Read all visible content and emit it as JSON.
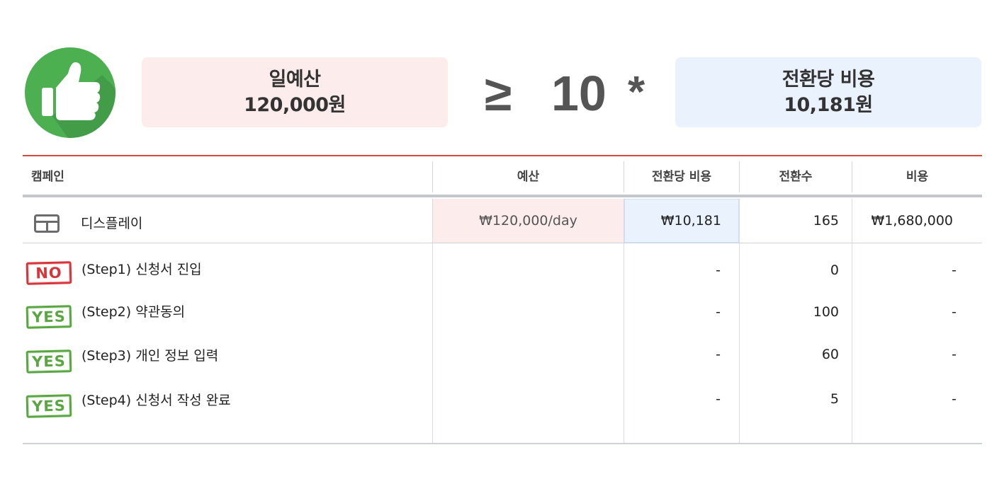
{
  "formula": {
    "budget_label": "일예산",
    "budget_value": "120,000원",
    "ge_sign": "≥",
    "multiplier": "10",
    "times_sign": "*",
    "cpa_label": "전환당 비용",
    "cpa_value": "10,181원"
  },
  "icons": {
    "approval": "thumbs-up-icon",
    "display": "display-banner-icon"
  },
  "colors": {
    "thumb_circle": "#4caf50",
    "budget_box": "#fcecec",
    "cpa_box": "#eaf3fd",
    "divider_red": "#d44a3a",
    "stamp_no": "#d8343c",
    "stamp_yes": "#5aa642"
  },
  "table": {
    "headers": {
      "campaign": "캠페인",
      "budget": "예산",
      "cpa": "전환당 비용",
      "conversions": "전환수",
      "cost": "비용"
    },
    "main_row": {
      "name": "디스플레이",
      "budget": "₩120,000/day",
      "cpa": "₩10,181",
      "conversions": "165",
      "cost": "₩1,680,000"
    },
    "steps": [
      {
        "stamp": "NO",
        "label": "(Step1) 신청서 진입",
        "cpa": "-",
        "conversions": "0",
        "cost": "-"
      },
      {
        "stamp": "YES",
        "label": "(Step2) 약관동의",
        "cpa": "-",
        "conversions": "100",
        "cost": "-"
      },
      {
        "stamp": "YES",
        "label": "(Step3) 개인 정보 입력",
        "cpa": "-",
        "conversions": "60",
        "cost": "-"
      },
      {
        "stamp": "YES",
        "label": "(Step4) 신청서 작성 완료",
        "cpa": "-",
        "conversions": "5",
        "cost": "-"
      }
    ]
  }
}
